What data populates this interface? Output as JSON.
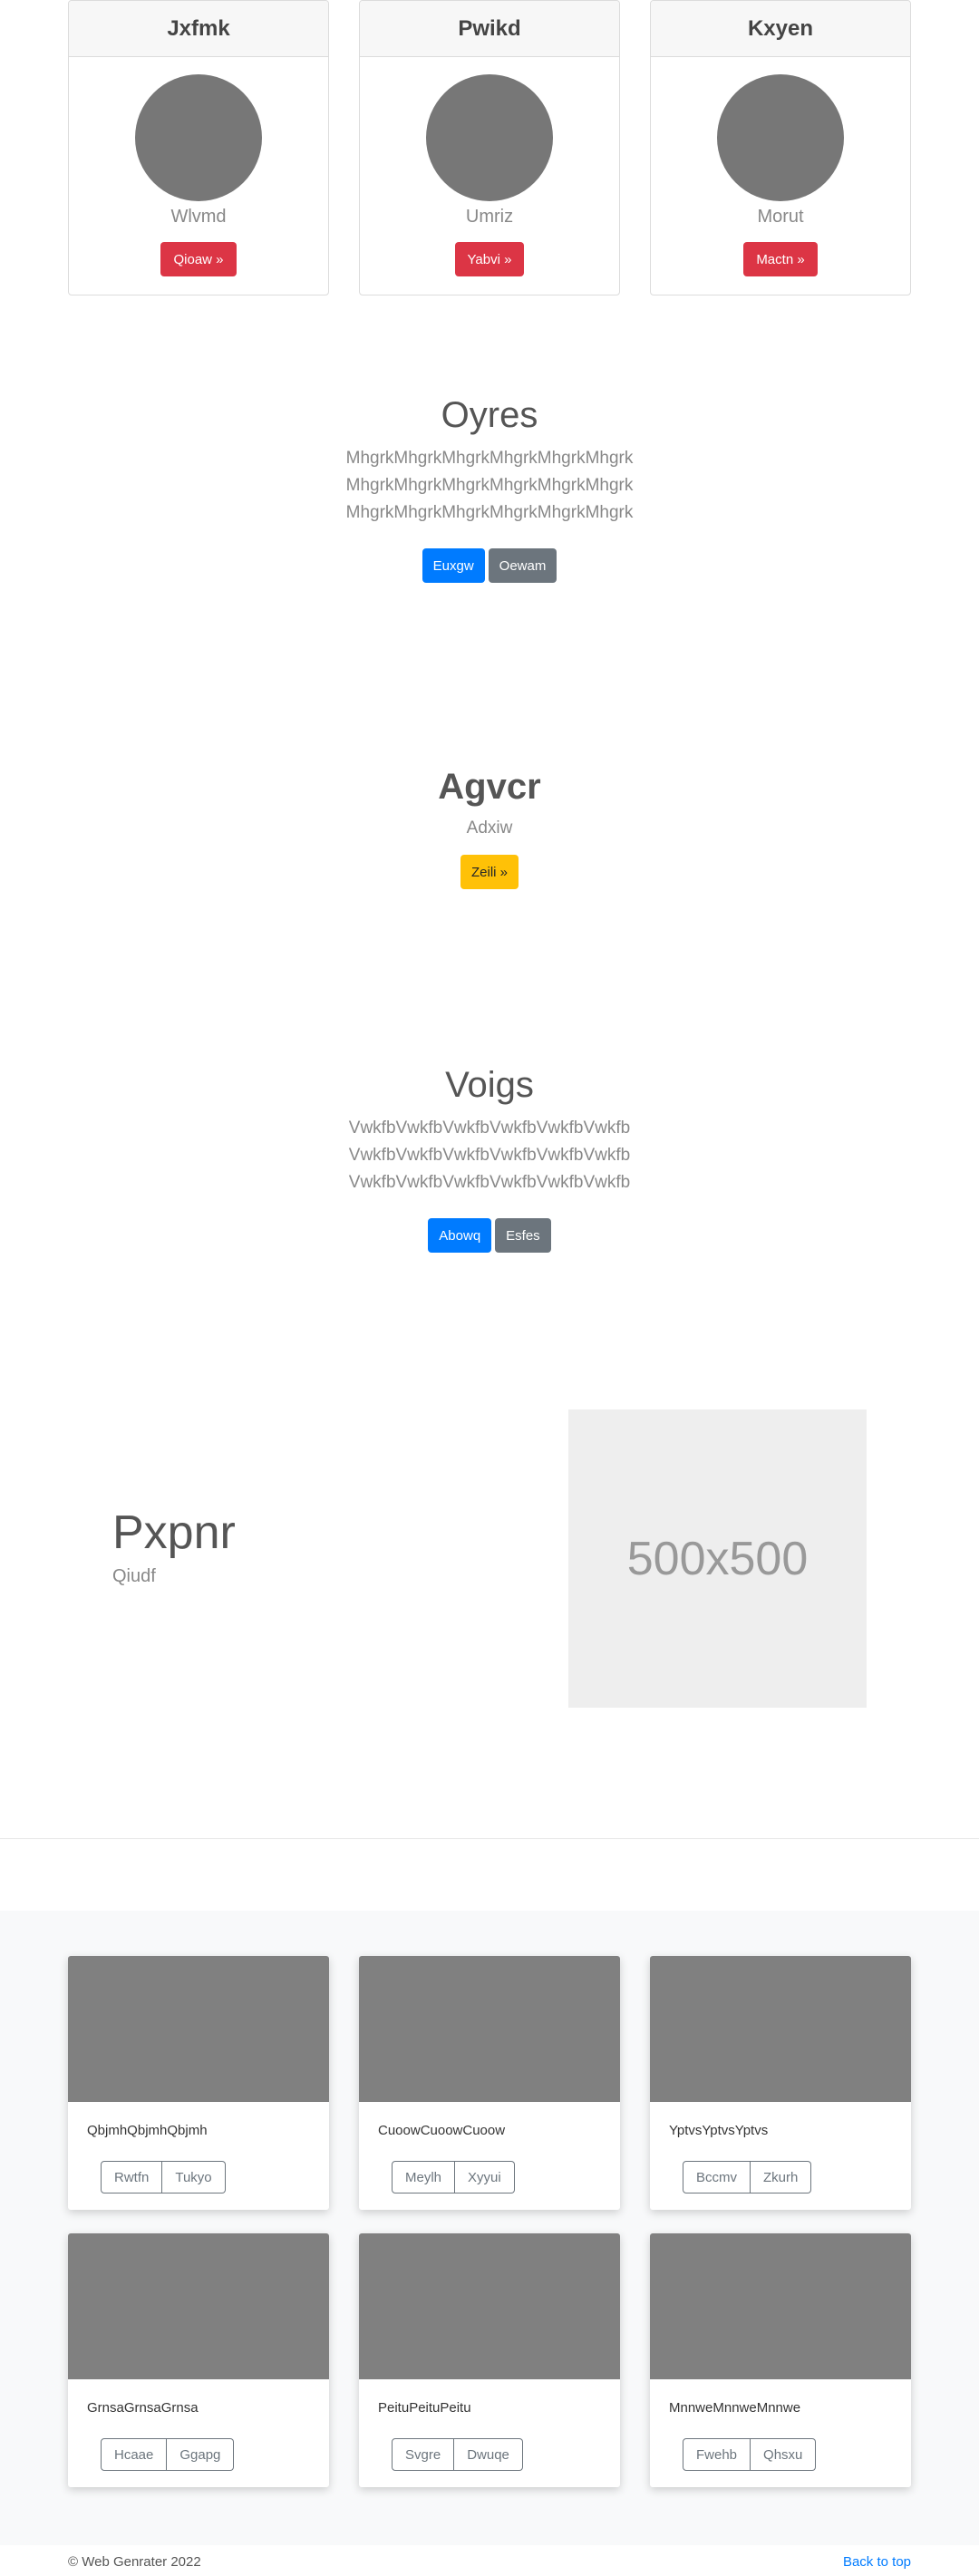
{
  "profiles": [
    {
      "header": "Jxfmk",
      "name": "Wlvmd",
      "button": "Qioaw »"
    },
    {
      "header": "Pwikd",
      "name": "Umriz",
      "button": "Yabvi »"
    },
    {
      "header": "Kxyen",
      "name": "Morut",
      "button": "Mactn »"
    }
  ],
  "section1": {
    "title": "Oyres",
    "lines": [
      "MhgrkMhgrkMhgrkMhgrkMhgrkMhgrk",
      "MhgrkMhgrkMhgrkMhgrkMhgrkMhgrk",
      "MhgrkMhgrkMhgrkMhgrkMhgrkMhgrk"
    ],
    "primary_button": "Euxgw",
    "secondary_button": "Oewam"
  },
  "hero": {
    "title": "Agvcr",
    "subtitle": "Adxiw",
    "button": "Zeili »"
  },
  "section2": {
    "title": "Voigs",
    "lines": [
      "VwkfbVwkfbVwkfbVwkfbVwkfbVwkfb",
      "VwkfbVwkfbVwkfbVwkfbVwkfbVwkfb",
      "VwkfbVwkfbVwkfbVwkfbVwkfbVwkfb"
    ],
    "primary_button": "Abowq",
    "secondary_button": "Esfes"
  },
  "feature": {
    "title": "Pxpnr",
    "subtitle": "Qiudf",
    "image_label": "500x500"
  },
  "album": [
    {
      "text": "QbjmhQbjmhQbjmh",
      "btn1": "Rwtfn",
      "btn2": "Tukyo"
    },
    {
      "text": "CuoowCuoowCuoow",
      "btn1": "Meylh",
      "btn2": "Xyyui"
    },
    {
      "text": "YptvsYptvsYptvs",
      "btn1": "Bccmv",
      "btn2": "Zkurh"
    },
    {
      "text": "GrnsaGrnsaGrnsa",
      "btn1": "Hcaae",
      "btn2": "Ggapg"
    },
    {
      "text": "PeituPeituPeitu",
      "btn1": "Svgre",
      "btn2": "Dwuqe"
    },
    {
      "text": "MnnweMnnweMnnwe",
      "btn1": "Fwehb",
      "btn2": "Qhsxu"
    }
  ],
  "footer": {
    "copyright": "© Web Genrater 2022",
    "back_to_top": "Back to top"
  },
  "colors": {
    "primary": "#007bff",
    "secondary": "#6c757d",
    "danger": "#dc3545",
    "warning": "#ffc107"
  }
}
